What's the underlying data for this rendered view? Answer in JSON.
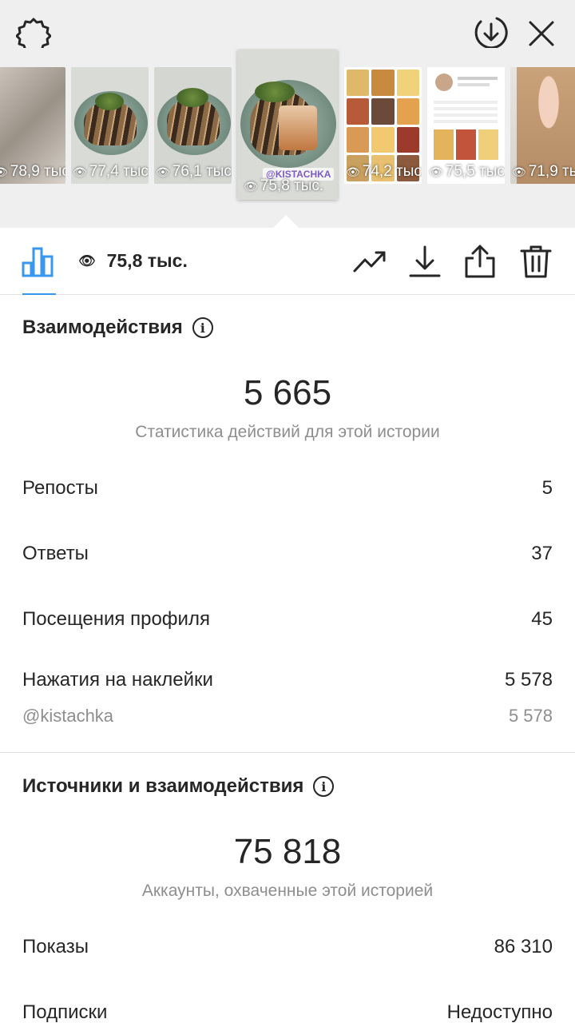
{
  "thumbnails": [
    {
      "views": "78,9 тыс."
    },
    {
      "views": "77,4 тыс."
    },
    {
      "views": "76,1 тыс."
    },
    {
      "views": "75,8 тыс.",
      "sticker": "@KISTACHKA"
    },
    {
      "views": "74,2 тыс."
    },
    {
      "views": "75,5 тыс."
    },
    {
      "views": "71,9 тыс."
    }
  ],
  "action_bar": {
    "views": "75,8 тыс."
  },
  "interactions": {
    "title": "Взаимодействия",
    "total": "5 665",
    "subtitle": "Статистика действий для этой истории",
    "rows": [
      {
        "label": "Репосты",
        "value": "5"
      },
      {
        "label": "Ответы",
        "value": "37"
      },
      {
        "label": "Посещения профиля",
        "value": "45"
      },
      {
        "label": "Нажатия на наклейки",
        "value": "5 578"
      }
    ],
    "sticker_row": {
      "label": "@kistachka",
      "value": "5 578"
    }
  },
  "discovery": {
    "title": "Источники и взаимодействия",
    "total": "75 818",
    "subtitle": "Аккаунты, охваченные этой историей",
    "rows": [
      {
        "label": "Показы",
        "value": "86 310"
      },
      {
        "label": "Подписки",
        "value": "Недоступно"
      }
    ]
  },
  "colors": {
    "accent": "#3897f0",
    "text": "#262626",
    "muted": "#8e8e8e",
    "strip_bg": "#efefef"
  }
}
